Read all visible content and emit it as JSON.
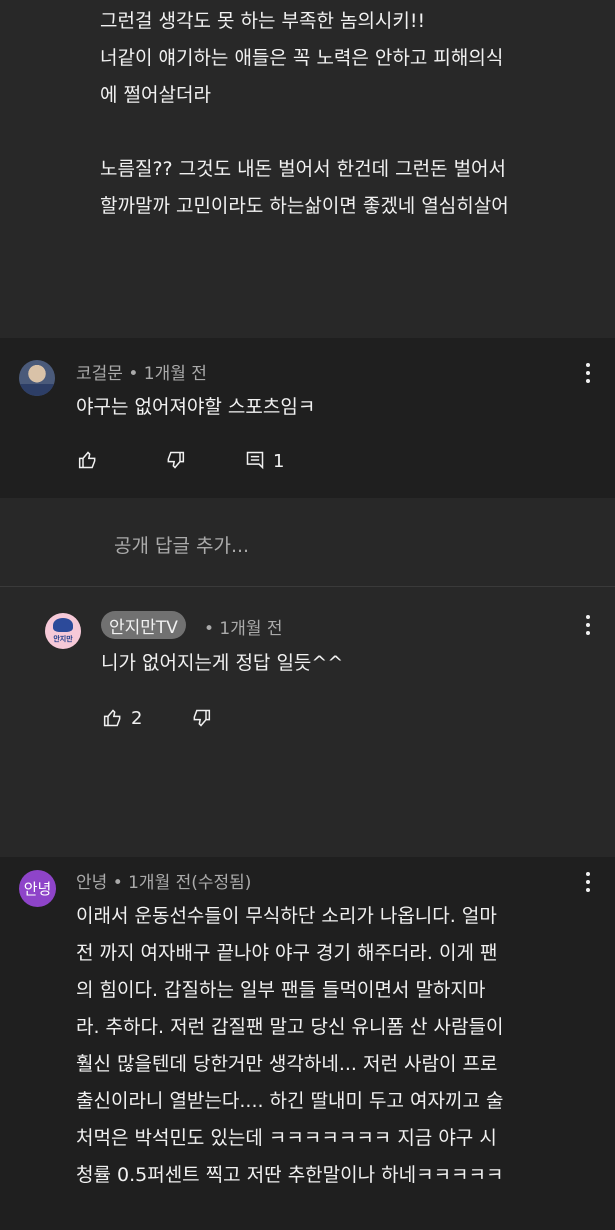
{
  "top_comment": {
    "text": "그런걸 생각도 못 하는 부족한 놈의시키!!\n너같이 얘기하는 애들은 꼭 노력은 안하고 피해의식\n에 쩔어살더라\n\n노름질?? 그것도 내돈 벌어서 한건데 그런돈 벌어서\n할까말까 고민이라도 하는삶이면 좋겠네 열심히살어"
  },
  "comment1": {
    "author": "코걸문",
    "time": "• 1개월 전",
    "text": "야구는 없어져야할 스포츠임ㅋ",
    "reply_count": "1",
    "icons": [
      "thumbs-up-icon",
      "thumbs-down-icon",
      "reply-icon",
      "more-vert-icon"
    ]
  },
  "reply_box": {
    "placeholder": "공개 답글 추가..."
  },
  "reply1": {
    "author": "안지만TV",
    "time": "• 1개월 전",
    "text": "니가 없어지는게 정답 일듯^^",
    "like_count": "2",
    "avatar_text": "안지만"
  },
  "comment2": {
    "avatar_text": "안녕",
    "author": "안녕",
    "time": "• 1개월 전(수정됨)",
    "text": "이래서 운동선수들이 무식하단 소리가 나옵니다. 얼마\n전 까지 여자배구 끝나야 야구 경기 해주더라. 이게 팬\n의 힘이다. 갑질하는 일부 팬들  들먹이면서 말하지마\n라. 추하다. 저런 갑질팬 말고 당신 유니폼 산 사람들이\n훨신 많을텐데 당한거만 생각하네... 저런 사람이 프로\n출신이라니 열받는다.... 하긴 딸내미 두고 여자끼고 술\n처먹은 박석민도 있는데 ㅋㅋㅋㅋㅋㅋㅋ 지금 야구 시\n청률 0.5퍼센트 찍고 저딴 추한말이나 하네ㅋㅋㅋㅋㅋ"
  },
  "colors": {
    "background": "#282828",
    "comment_bg": "#1f1f1f",
    "text": "#f1f1f1",
    "meta": "#aaaaaa",
    "avatar_purple": "#8e44c9"
  }
}
